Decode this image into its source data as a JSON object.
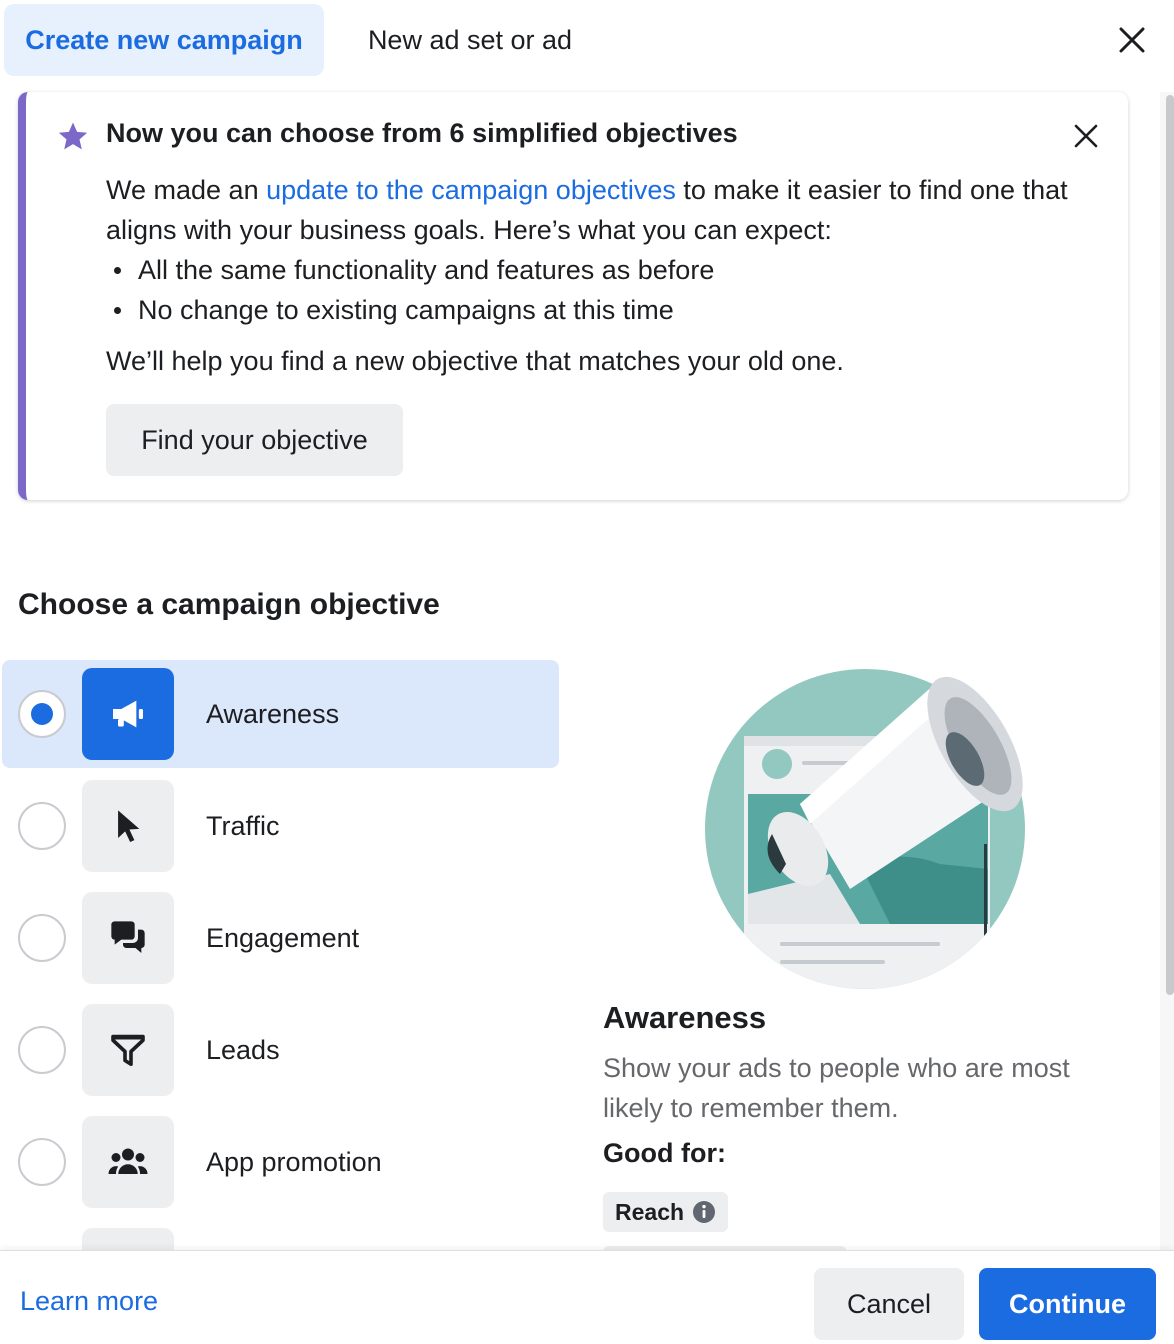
{
  "header": {
    "tabs": [
      {
        "label": "Create new campaign",
        "active": true
      },
      {
        "label": "New ad set or ad",
        "active": false
      }
    ],
    "close_icon": "close-icon"
  },
  "notice": {
    "title": "Now you can choose from 6 simplified objectives",
    "body_prefix": "We made an ",
    "body_link": "update to the campaign objectives",
    "body_suffix": " to make it easier to find one that aligns with your business goals. Here’s what you can expect:",
    "bullets": [
      "All the same functionality and features as before",
      "No change to existing campaigns at this time"
    ],
    "help_text": "We’ll help you find a new objective that matches your old one.",
    "button_label": "Find your objective",
    "accent_color": "#7b68c8"
  },
  "objectives": {
    "title": "Choose a campaign objective",
    "selected": "Awareness",
    "items": [
      {
        "label": "Awareness",
        "icon": "megaphone-icon",
        "selected": true
      },
      {
        "label": "Traffic",
        "icon": "cursor-icon",
        "selected": false
      },
      {
        "label": "Engagement",
        "icon": "chat-bubbles-icon",
        "selected": false
      },
      {
        "label": "Leads",
        "icon": "funnel-icon",
        "selected": false
      },
      {
        "label": "App promotion",
        "icon": "people-icon",
        "selected": false
      }
    ]
  },
  "detail": {
    "title": "Awareness",
    "description": "Show your ads to people who are most likely to remember them.",
    "good_for_label": "Good for:",
    "tags": [
      "Reach"
    ]
  },
  "footer": {
    "learn_more": "Learn more",
    "cancel": "Cancel",
    "continue": "Continue"
  },
  "colors": {
    "primary": "#1b6ce0",
    "selected_bg": "#dbe7fb",
    "tab_active_bg": "#e7f0fd"
  }
}
